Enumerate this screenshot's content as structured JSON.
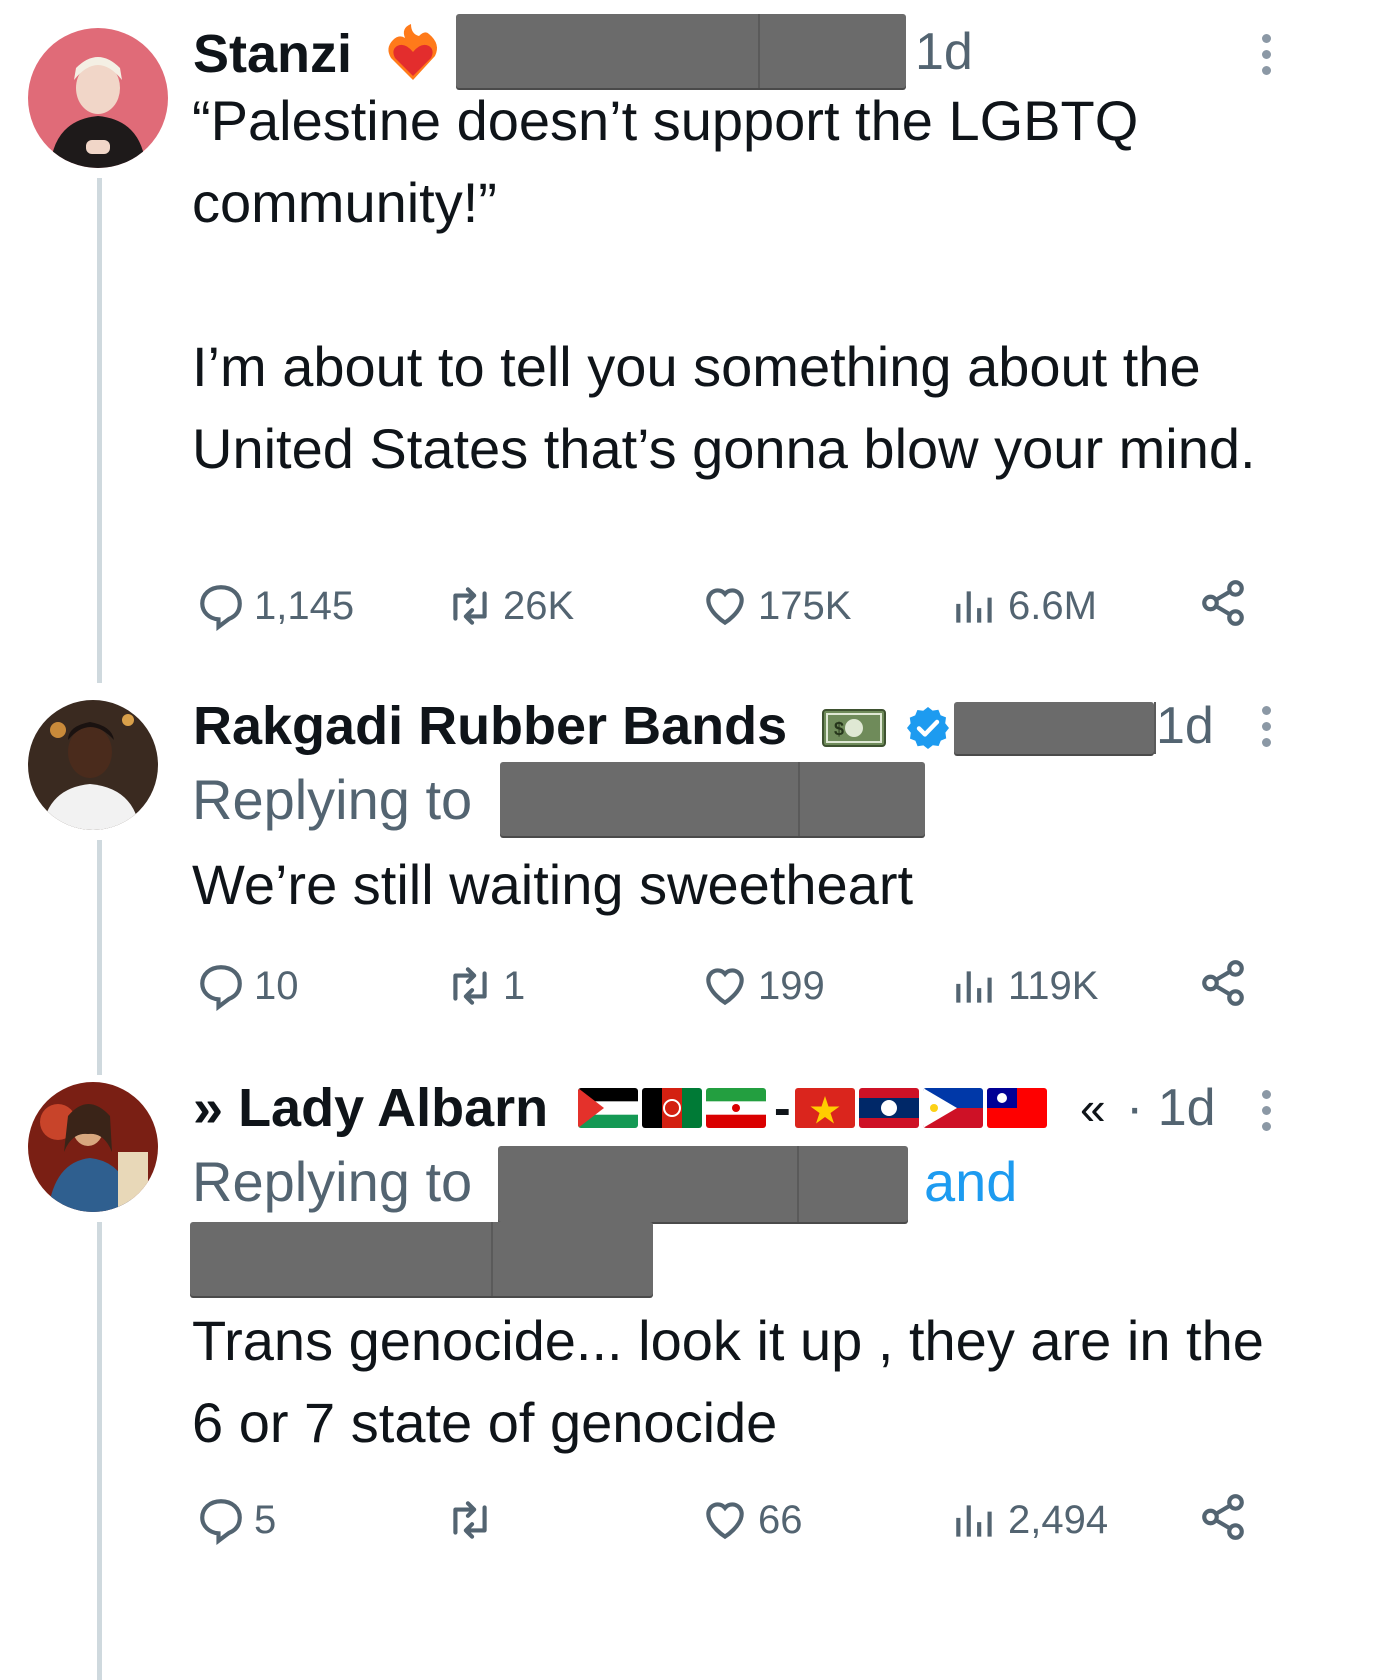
{
  "tweets": [
    {
      "name": "Stanzi",
      "badge_icon": "fire-heart-emoji",
      "time": "1d",
      "text": "“Palestine doesn’t support the LGBTQ community!”\n\nI’m about to tell you something about the United States that’s gonna blow your mind.",
      "replies": "1,145",
      "retweets": "26K",
      "likes": "175K",
      "views": "6.6M"
    },
    {
      "name": "Rakgadi Rubber Bands",
      "badge_icon": "dollar-bill-emoji",
      "verified_icon": "verified-badge-icon",
      "time": "1d",
      "replying_to": "Replying to",
      "text": "We’re still waiting sweetheart",
      "replies": "10",
      "retweets": "1",
      "likes": "199",
      "views": "119K"
    },
    {
      "name_prefix": "»",
      "name": "Lady Albarn",
      "name_suffix": "«",
      "flags": [
        "palestine-flag",
        "afghanistan-flag",
        "iran-flag",
        "vietnam-flag",
        "laos-flag",
        "philippines-flag",
        "taiwan-flag"
      ],
      "flag_dash": "-",
      "time": "· 1d",
      "replying_to": "Replying to",
      "and_label": "and",
      "text": "Trans genocide... look it up , they are in the 6 or 7 state of genocide",
      "replies": "5",
      "retweets": "",
      "likes": "66",
      "views": "2,494"
    }
  ],
  "colors": {
    "text_primary": "#0f1419",
    "text_secondary": "#536471",
    "link_blue": "#1d9bf0",
    "thread_line": "#cfd9de",
    "redaction": "#6b6b6b"
  }
}
